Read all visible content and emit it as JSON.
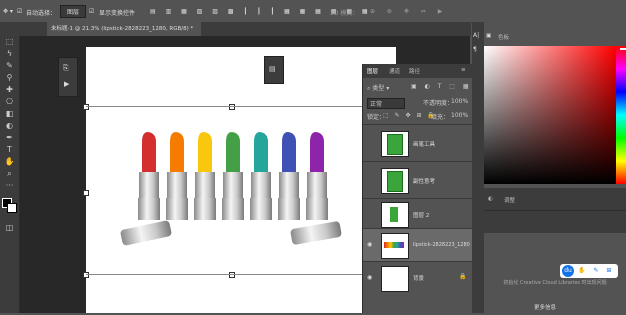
{
  "options_bar": {
    "auto_select_label": "自动选择：",
    "auto_select_value": "图层",
    "show_transform_label": "显示变换控件",
    "mode_3d": "3D 模式："
  },
  "document_tab": {
    "title": "未标题-1 @ 21.3% (lipstick-2828223_1280, RGB/8) *"
  },
  "layers_panel": {
    "tabs": [
      "图层",
      "通道",
      "路径"
    ],
    "filter_kind": "类型",
    "blend_mode": "正常",
    "opacity_label": "不透明度：",
    "opacity_value": "100%",
    "lock_label": "锁定：",
    "fill_label": "填充：",
    "fill_value": "100%",
    "layers": [
      {
        "name": "画笔工具"
      },
      {
        "name": "副性意考"
      },
      {
        "name": "图层 2"
      },
      {
        "name": "lipstick-2828223_1280"
      },
      {
        "name": "背景"
      }
    ]
  },
  "color_panel": {
    "tab_label": "色板",
    "adjust_tab": "调整"
  },
  "library_panel": {
    "message": "初始化 Creative Cloud Libraries 时出现问题",
    "more_info": "更多信息"
  },
  "colors": {
    "accent": "#1473e6",
    "lipsticks": [
      "#d32f2f",
      "#f57c00",
      "#f9c80e",
      "#43a047",
      "#26a69a",
      "#3f51b5",
      "#8e24aa"
    ]
  }
}
